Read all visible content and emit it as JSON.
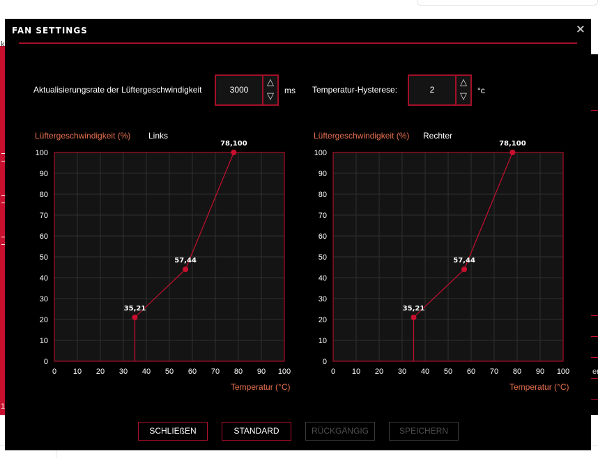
{
  "background": {
    "left_strip_text_1": "ke",
    "left_strip_text_2": "1",
    "right_strip_text": "er"
  },
  "dialog": {
    "title": "FAN SETTINGS",
    "close_symbol": "×"
  },
  "update_rate": {
    "label": "Aktualisierungsrate der Lüftergeschwindigkeit",
    "value": "3000",
    "unit": "ms",
    "up_symbol": "△",
    "down_symbol": "▽"
  },
  "hysteresis": {
    "label": "Temperatur-Hysterese:",
    "value": "2",
    "unit": "°c",
    "up_symbol": "△",
    "down_symbol": "▽"
  },
  "charts": {
    "left": {
      "ylabel": "Lüftergeschwindigkeit (%)",
      "side": "Links",
      "xlabel": "Temperatur (°C)"
    },
    "right": {
      "ylabel": "Lüftergeschwindigkeit (%)",
      "side": "Rechter",
      "xlabel": "Temperatur (°C)"
    }
  },
  "chart_data": [
    {
      "type": "line",
      "side": "Links",
      "xlabel": "Temperatur (°C)",
      "ylabel": "Lüftergeschwindigkeit (%)",
      "xlim": [
        0,
        100
      ],
      "ylim": [
        0,
        100
      ],
      "xticks": [
        "0",
        "10",
        "20",
        "30",
        "40",
        "50",
        "60",
        "70",
        "80",
        "90",
        "100"
      ],
      "yticks": [
        "0",
        "10",
        "20",
        "30",
        "40",
        "50",
        "60",
        "70",
        "80",
        "90",
        "100"
      ],
      "grid": true,
      "points": [
        {
          "x": 35,
          "y": 21,
          "label": "35,21"
        },
        {
          "x": 57,
          "y": 44,
          "label": "57,44"
        },
        {
          "x": 78,
          "y": 100,
          "label": "78,100"
        }
      ],
      "line_color": "#c8102e"
    },
    {
      "type": "line",
      "side": "Rechter",
      "xlabel": "Temperatur (°C)",
      "ylabel": "Lüftergeschwindigkeit (%)",
      "xlim": [
        0,
        100
      ],
      "ylim": [
        0,
        100
      ],
      "xticks": [
        "0",
        "10",
        "20",
        "30",
        "40",
        "50",
        "60",
        "70",
        "80",
        "90",
        "100"
      ],
      "yticks": [
        "0",
        "10",
        "20",
        "30",
        "40",
        "50",
        "60",
        "70",
        "80",
        "90",
        "100"
      ],
      "grid": true,
      "points": [
        {
          "x": 35,
          "y": 21,
          "label": "35,21"
        },
        {
          "x": 57,
          "y": 44,
          "label": "57,44"
        },
        {
          "x": 78,
          "y": 100,
          "label": "78,100"
        }
      ],
      "line_color": "#c8102e"
    }
  ],
  "buttons": {
    "close": "SCHLIEßEN",
    "default": "STANDARD",
    "undo": "RÜCKGÄNGIG",
    "save": "SPEICHERN"
  },
  "colors": {
    "accent": "#c8102e",
    "dialog_bg": "#000000",
    "plot_bg": "#141414",
    "label_orange": "#e8704f"
  }
}
